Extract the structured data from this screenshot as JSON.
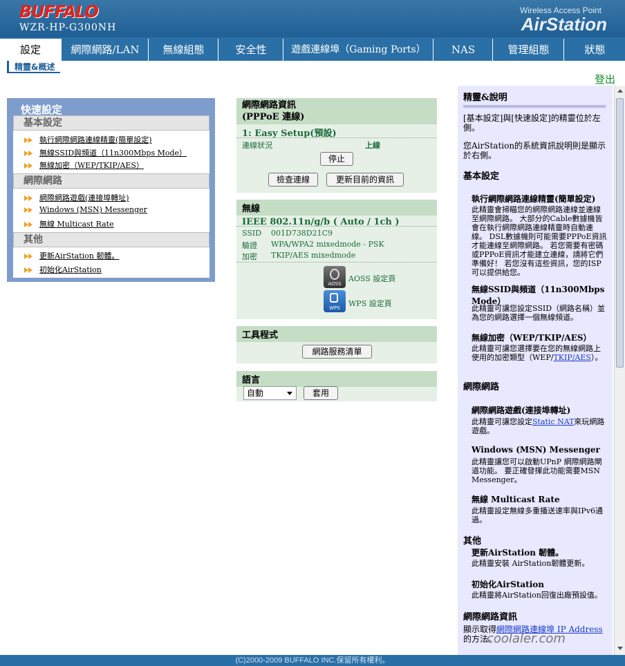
{
  "header": {
    "brand_logo": "BUFFALO",
    "model": "WZR-HP-G300NH",
    "product_line": "Wireless Access Point",
    "product_name": "AirStation"
  },
  "nav": {
    "tabs": [
      {
        "label": "設定"
      },
      {
        "label": "網際網路/LAN"
      },
      {
        "label": "無線組態"
      },
      {
        "label": "安全性"
      },
      {
        "label": "遊戲連線埠（Gaming Ports）"
      },
      {
        "label": "NAS"
      },
      {
        "label": "管理組態"
      },
      {
        "label": "狀態"
      }
    ],
    "active": "設定"
  },
  "subnav": {
    "active": "精靈&概述",
    "logout": "登出"
  },
  "quick_setup": {
    "title": "快速設定",
    "sections": [
      {
        "label": "基本設定",
        "links": [
          "執行網際網路連線精靈(簡單設定)",
          "無線SSID與頻道（11n300Mbps Mode）",
          "無線加密（WEP/TKIP/AES）"
        ]
      },
      {
        "label": "網際網路",
        "links": [
          "網際網路遊戲(連接埠轉址)",
          "Windows (MSN) Messenger",
          "無線 Multicast Rate"
        ]
      },
      {
        "label": "其他",
        "links": [
          "更新AirStation 韌體。",
          "初始化AirStation"
        ]
      }
    ]
  },
  "internet": {
    "title": "網際網路資訊",
    "type": "(PPPoE 連線)",
    "mode": "1: Easy Setup(預設)",
    "status_label": "連線狀況",
    "status_value": "上線",
    "stop": "停止",
    "check": "檢查連線",
    "refresh": "更新目前的資訊"
  },
  "wireless": {
    "title": "無線",
    "standard": "IEEE 802.11n/g/b ( Auto / 1ch )",
    "rows": [
      {
        "k": "SSID",
        "v": "001D738D21C9"
      },
      {
        "k": "驗證",
        "v": "WPA/WPA2 mixedmode - PSK"
      },
      {
        "k": "加密",
        "v": "TKIP/AES mixedmode"
      }
    ],
    "aoss_icon_label": "AOSS",
    "wps_icon_label": "WPS",
    "aoss": "AOSS 設定頁",
    "wps": "WPS 設定頁"
  },
  "tools": {
    "title": "工具程式",
    "button": "網路服務清單"
  },
  "language": {
    "title": "語言",
    "selected": "自動",
    "apply": "套用"
  },
  "help": {
    "title": "精靈&說明",
    "intro1": "[基本設定]與[快速設定]的精靈位於左側。",
    "intro2": "您AirStation的系統資訊說明則是顯示於右側。",
    "basic": "基本設定",
    "wizard_title": "執行網際網路連線精靈(簡單設定)",
    "wizard_text": "此精靈會掃瞄您的網際網路連線並連線至網際網路。 大部分的Cable數據機皆會在執行網際網路連線精靈時自動連線。 DSL數據機則可能需要PPPoE資訊才能連線至網際網路。 若您需要有密碼或PPPoE資訊才能建立連線，請將它們準備好！ 若您沒有這些資訊，您的ISP可以提供給您。",
    "ssid_title": "無線SSID與頻道（11n300Mbps Mode）",
    "ssid_text": "此精靈可讓您設定SSID（網路名稱）並為您的網路選擇一個無線頻道。",
    "enc_title": "無線加密（WEP/TKIP/AES）",
    "enc_text_a": "此精靈可讓您選擇要在您的無線網路上使用的加密類型（WEP/",
    "enc_text_link": "TKIP/AES",
    "enc_text_b": "）。",
    "internet": "網際網路",
    "game_title": "網際網路遊戲(連接埠轉址)",
    "game_text_a": "此精靈可讓您設定",
    "game_text_link": "Static NAT",
    "game_text_b": "來玩網路遊戲。",
    "msn_title": "Windows (MSN) Messenger",
    "msn_text": "此精靈讓您可以啟動UPnP 網際網路閘道功能。 要正確發揮此功能需要MSN Messenger。",
    "mc_title": "無線 Multicast Rate",
    "mc_text": "此精靈設定無線多重播送速率與IPv6通過。",
    "other": "其他",
    "fw_title": "更新AirStation 韌體。",
    "fw_text": "此精靈安裝 AirStation韌體更新。",
    "init_title": "初始化AirStation",
    "init_text": "此精靈將AirStation回復出廠預設值。",
    "netinfo": "網際網路資訊",
    "netinfo_text_a": "顯示取得",
    "netinfo_text_link": "網際網路連線埠 IP Address",
    "netinfo_text_b": "的方法。"
  },
  "footer": {
    "copyright": "(C)2000-2009 BUFFALO INC.保留所有權利。"
  },
  "watermark": "coolaler.com"
}
